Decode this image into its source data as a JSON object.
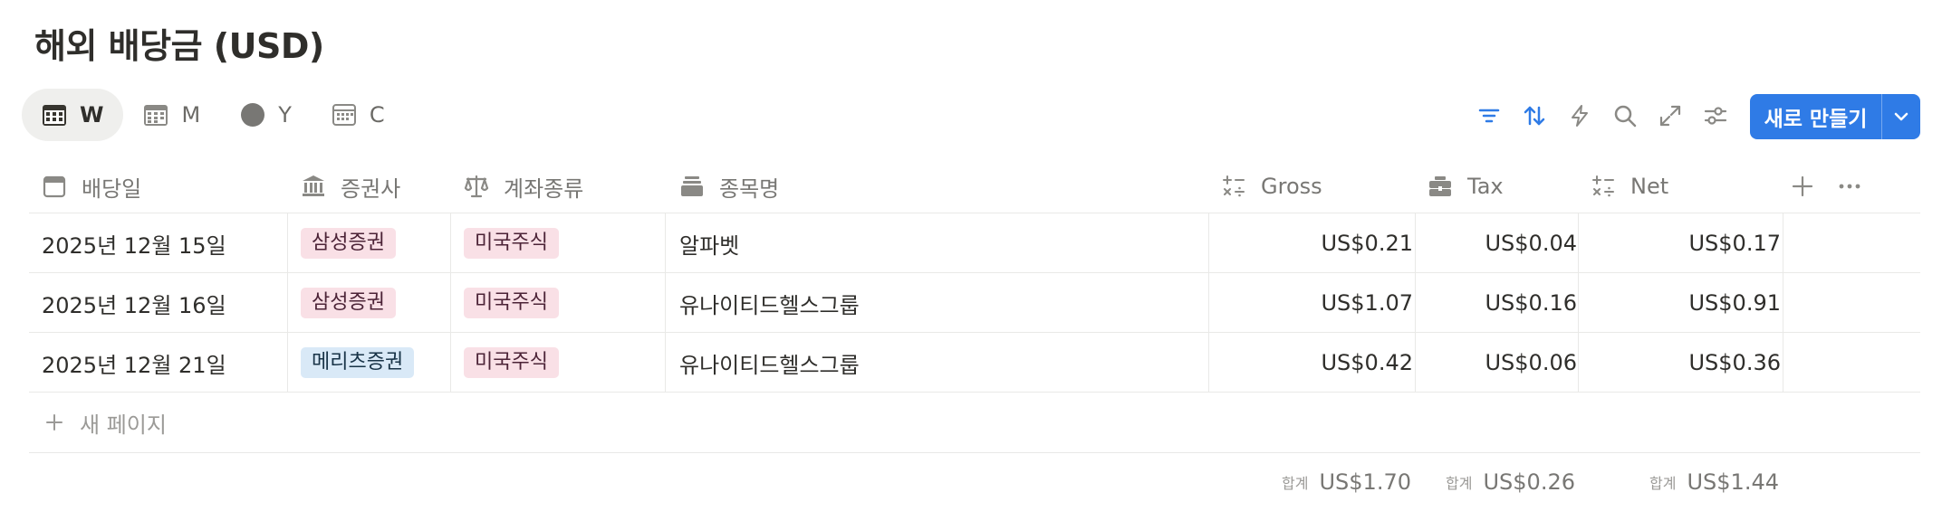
{
  "title": "해외 배당금 (USD)",
  "tabs": [
    {
      "label": "W",
      "icon": "calendar-week-icon",
      "active": true
    },
    {
      "label": "M",
      "icon": "calendar-month-icon",
      "active": false
    },
    {
      "label": "Y",
      "icon": "circle-icon",
      "active": false
    },
    {
      "label": "C",
      "icon": "calendar-icon",
      "active": false
    }
  ],
  "toolbar": {
    "icons": [
      "filter-icon",
      "sort-icon",
      "automation-icon",
      "search-icon",
      "expand-icon",
      "settings-icon"
    ],
    "new_label": "새로 만들기",
    "accent": "#2f7be6"
  },
  "columns": [
    {
      "label": "배당일",
      "icon": "calendar-icon"
    },
    {
      "label": "증권사",
      "icon": "bank-icon"
    },
    {
      "label": "계좌종류",
      "icon": "scale-icon"
    },
    {
      "label": "종목명",
      "icon": "stack-icon"
    },
    {
      "label": "Gross",
      "icon": "formula-icon"
    },
    {
      "label": "Tax",
      "icon": "folder-icon"
    },
    {
      "label": "Net",
      "icon": "formula-icon"
    }
  ],
  "rows": [
    {
      "date": "2025년 12월 15일",
      "broker": "삼성증권",
      "broker_color": "pink",
      "account": "미국주식",
      "stock": "알파벳",
      "gross": "US$0.21",
      "tax": "US$0.04",
      "net": "US$0.17"
    },
    {
      "date": "2025년 12월 16일",
      "broker": "삼성증권",
      "broker_color": "pink",
      "account": "미국주식",
      "stock": "유나이티드헬스그룹",
      "gross": "US$1.07",
      "tax": "US$0.16",
      "net": "US$0.91"
    },
    {
      "date": "2025년 12월 21일",
      "broker": "메리츠증권",
      "broker_color": "blue",
      "account": "미국주식",
      "stock": "유나이티드헬스그룹",
      "gross": "US$0.42",
      "tax": "US$0.06",
      "net": "US$0.36"
    }
  ],
  "new_page_label": "새 페이지",
  "totals": {
    "label": "합계",
    "gross": "US$1.70",
    "tax": "US$0.26",
    "net": "US$1.44"
  }
}
